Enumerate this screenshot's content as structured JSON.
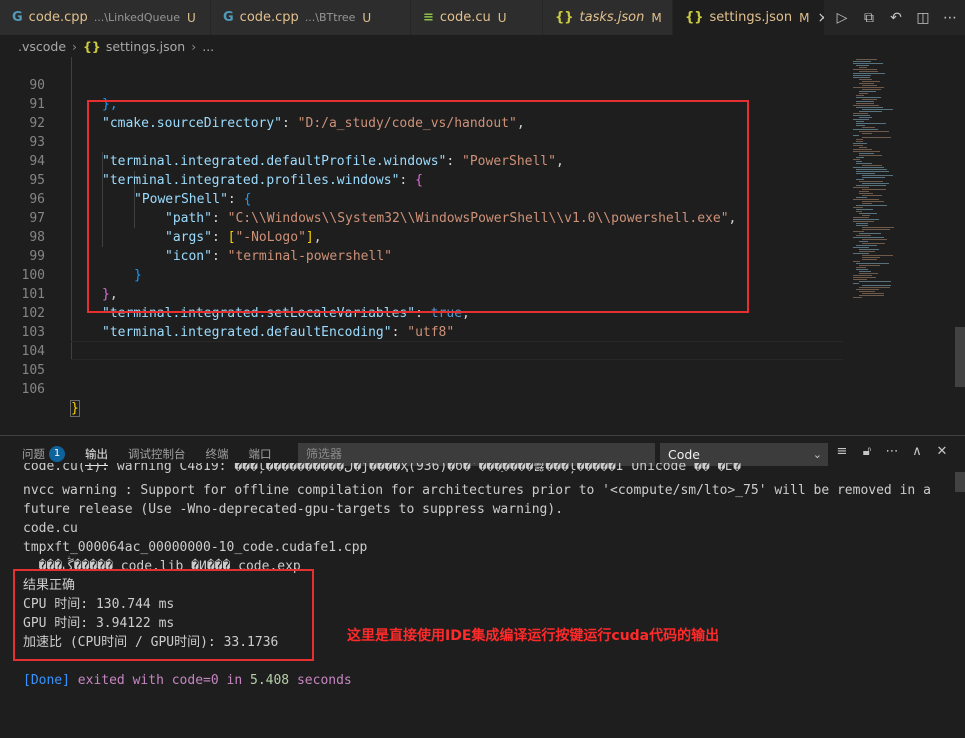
{
  "tabs": [
    {
      "name": "code.cpp",
      "desc": "...\\LinkedQueue",
      "status": "U",
      "icon": "C++"
    },
    {
      "name": "code.cpp",
      "desc": "...\\BTtree",
      "status": "U",
      "icon": "C++"
    },
    {
      "name": "code.cu",
      "desc": "",
      "status": "U",
      "icon": "cuda"
    },
    {
      "name": "tasks.json",
      "desc": "",
      "status": "M",
      "icon": "{}"
    },
    {
      "name": "settings.json",
      "desc": "",
      "status": "M",
      "icon": "{}"
    }
  ],
  "tab_close": "×",
  "breadcrumb": {
    "folder": ".vscode",
    "file": "settings.json",
    "more": "..."
  },
  "editor": {
    "line_numbers": [
      "90",
      "91",
      "92",
      "93",
      "94",
      "95",
      "96",
      "97",
      "98",
      "99",
      "100",
      "101",
      "102",
      "103",
      "104",
      "105",
      "106"
    ],
    "l90": "},",
    "l91_key": "\"cmake.sourceDirectory\"",
    "l91_val": "\"D:/a_study/code_vs/handout\"",
    "l93_key": "\"terminal.integrated.defaultProfile.windows\"",
    "l93_val": "\"PowerShell\"",
    "l94_key": "\"terminal.integrated.profiles.windows\"",
    "l95_key": "\"PowerShell\"",
    "l96_key": "\"path\"",
    "l96_val": "\"C:\\\\Windows\\\\System32\\\\WindowsPowerShell\\\\v1.0\\\\powershell.exe\"",
    "l97_key": "\"args\"",
    "l97_val": "\"-NoLogo\"",
    "l98_key": "\"icon\"",
    "l98_val": "\"terminal-powershell\"",
    "l101_key": "\"terminal.integrated.setLocaleVariables\"",
    "l101_val": "true",
    "l102_key": "\"terminal.integrated.defaultEncoding\"",
    "l102_val": "\"utf8\""
  },
  "panel": {
    "tabs": [
      "问题",
      "输出",
      "调试控制台",
      "终端",
      "端口"
    ],
    "problem_count": "1",
    "filter_placeholder": "筛选器",
    "channel": "Code"
  },
  "output": [
    "code.cu(1): warning C4819: ���ļ����������ڵ�ǰ����ҳ(936)�б�ʾ���ַ����뽫���ļ�����Ϊ Unicode ��ʽ�Է�",
    "nvcc warning : Support for offline compilation for architectures prior to '<compute/sm/lto>_75' will be removed in a",
    "future release (Use -Wno-deprecated-gpu-targets to suppress warning).",
    "code.cu",
    "tmpxft_000064ac_00000000-10_code.cudafe1.cpp",
    "  ���ڴ����� code.lib �Ͷ��� code.exp",
    "结果正确",
    "CPU 时间: 130.744 ms",
    "GPU 时间: 3.94122 ms",
    "加速比 (CPU时间 / GPU时间): 33.1736"
  ],
  "done": {
    "tag": "[Done]",
    "text1": "exited with",
    "code": "code=0",
    "text2": "in",
    "secs": "5.408",
    "text3": "seconds"
  },
  "annotation": "这里是直接使用IDE集成编译运行按键运行cuda代码的输出",
  "colors": {
    "red_box": "#e5302f",
    "accent": "#0e639c",
    "annotation": "#ff2a2a"
  }
}
